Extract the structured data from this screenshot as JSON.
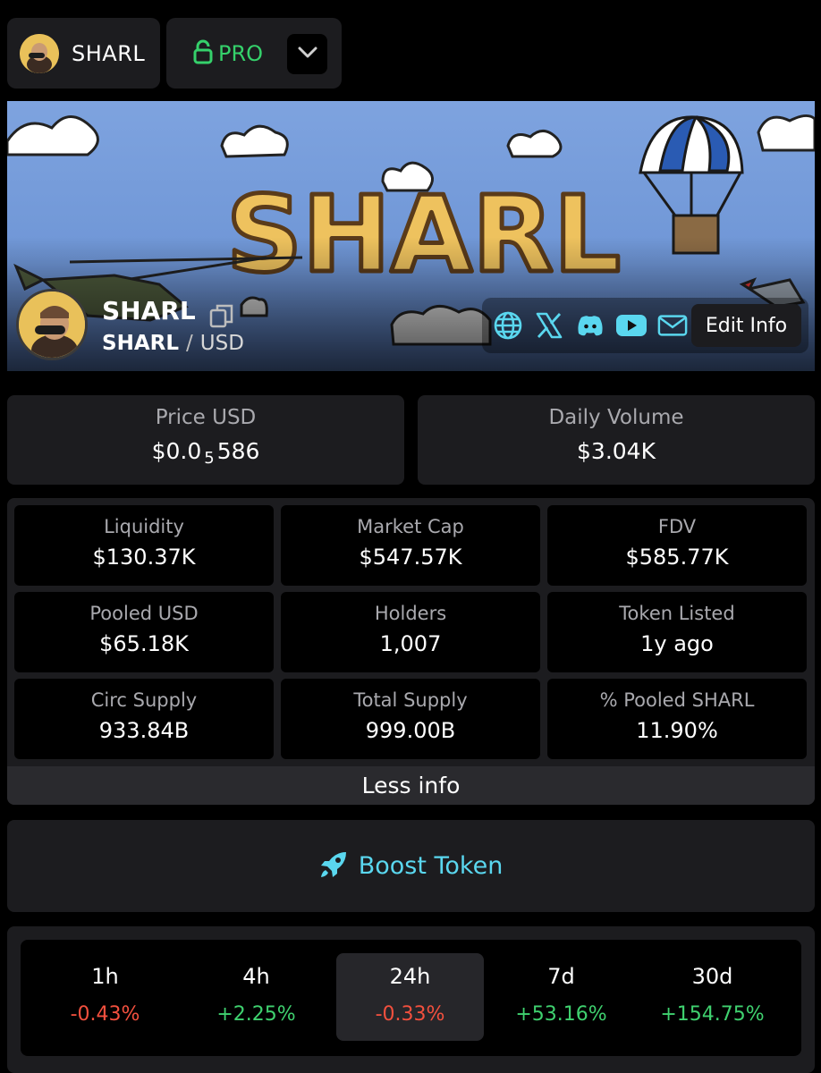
{
  "header": {
    "token_chip_label": "SHARL",
    "pro_label": "PRO"
  },
  "banner": {
    "title_art_text": "SHARL",
    "token_name": "SHARL",
    "pair_base": "SHARL",
    "pair_separator": "/",
    "pair_quote": "USD",
    "edit_button_label": "Edit Info",
    "social_icons": [
      "globe-icon",
      "x-icon",
      "discord-icon",
      "youtube-icon",
      "mail-icon"
    ]
  },
  "price": {
    "label": "Price USD",
    "value_prefix": "$0.0",
    "value_zeros": "5",
    "value_digits": "586"
  },
  "volume": {
    "label": "Daily Volume",
    "value": "$3.04K"
  },
  "stats": [
    {
      "label": "Liquidity",
      "value": "$130.37K"
    },
    {
      "label": "Market Cap",
      "value": "$547.57K"
    },
    {
      "label": "FDV",
      "value": "$585.77K"
    },
    {
      "label": "Pooled USD",
      "value": "$65.18K"
    },
    {
      "label": "Holders",
      "value": "1,007"
    },
    {
      "label": "Token Listed",
      "value": "1y ago"
    },
    {
      "label": "Circ Supply",
      "value": "933.84B"
    },
    {
      "label": "Total Supply",
      "value": "999.00B"
    },
    {
      "label": "% Pooled SHARL",
      "value": "11.90%"
    }
  ],
  "less_info_label": "Less info",
  "boost_label": "Boost Token",
  "timeframes": [
    {
      "period": "1h",
      "change": "-0.43%",
      "direction": "down"
    },
    {
      "period": "4h",
      "change": "+2.25%",
      "direction": "up"
    },
    {
      "period": "24h",
      "change": "-0.33%",
      "direction": "down",
      "selected": true
    },
    {
      "period": "7d",
      "change": "+53.16%",
      "direction": "up"
    },
    {
      "period": "30d",
      "change": "+154.75%",
      "direction": "up"
    }
  ],
  "colors": {
    "pro_green": "#35d16b",
    "boost_cyan": "#5ad7ef",
    "negative": "#f3503e",
    "positive": "#3fd16f",
    "panel": "#1c1c1f"
  }
}
